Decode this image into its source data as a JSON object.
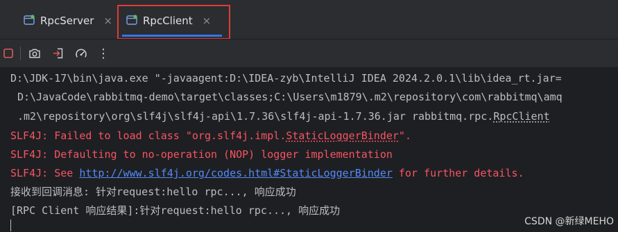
{
  "tabs": [
    {
      "label": "RpcServer",
      "close": "×",
      "active": false
    },
    {
      "label": "RpcClient",
      "close": "×",
      "active": true
    }
  ],
  "toolbar": {
    "items": [
      "stop-icon",
      "camera-icon",
      "exit-icon",
      "gauge-icon",
      "more-icon"
    ],
    "more_glyph": "⋮"
  },
  "colors": {
    "background": "#1e1f22",
    "toolbar_bg": "#2b2d30",
    "error_text": "#f75464",
    "link": "#548af7",
    "normal_text": "#bcbec4",
    "accent": "#3574f0",
    "highlight_box": "#e03a3a",
    "stop_button": "#db5c5c"
  },
  "console": {
    "line1": "D:\\JDK-17\\bin\\java.exe \"-javaagent:D:\\IDEA-zyb\\IntelliJ IDEA 2024.2.0.1\\lib\\idea_rt.jar=",
    "line2": "D:\\JavaCode\\rabbitmq-demo\\target\\classes;C:\\Users\\m1879\\.m2\\repository\\com\\rabbitmq\\amq",
    "line3_prefix": ".m2\\repository\\org\\slf4j\\slf4j-api\\1.7.36\\slf4j-api-1.7.36.jar rabbitmq.rpc.",
    "line3_class": "RpcClient",
    "line4_prefix": "SLF4J: Failed to load class \"org.slf4j.impl.",
    "line4_class": "StaticLoggerBinder",
    "line4_suffix": "\".",
    "line5": "SLF4J: Defaulting to no-operation (NOP) logger implementation",
    "line6_prefix": "SLF4J: See ",
    "line6_link": "http://www.slf4j.org/codes.html#StaticLoggerBinder",
    "line6_suffix": " for further details.",
    "line7": "接收到回调消息: 针对request:hello rpc..., 响应成功",
    "line8": "[RPC Client 响应结果]:针对request:hello rpc..., 响应成功"
  },
  "watermark": "CSDN @新绿MEHO"
}
